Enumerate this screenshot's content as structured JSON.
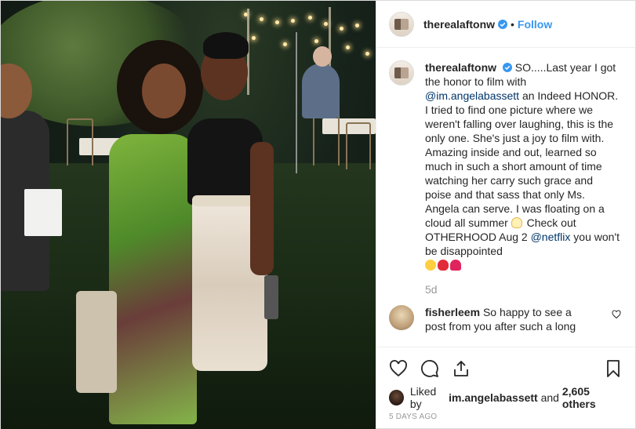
{
  "post": {
    "author": "therealaftonw",
    "dot": "•",
    "follow_label": "Follow"
  },
  "caption": {
    "author": "therealaftonw",
    "part1": "SO.....Last year I got the honor to film with ",
    "mention1": "@im.angelabassett",
    "part2": " an Indeed HONOR. I tried to find one picture where we weren't falling over laughing, this is the only one. She's just a joy to film with. Amazing inside and out, learned so much in such a short amount of time watching her carry such grace and poise and that sass that only Ms. Angela can serve. I was floating on a cloud all summer ",
    "part3": " Check out OTHERHOOD Aug 2 ",
    "mention2": "@netflix",
    "part4": " you won't be disappointed",
    "age": "5d",
    "emojis": [
      "cloud-emoji",
      "grin-emoji",
      "lips-emoji",
      "heart-emoji"
    ]
  },
  "comment": {
    "author": "fisherleem",
    "text": "So happy to see a post from you after such a long"
  },
  "likes": {
    "prefix": "Liked by ",
    "user": "im.angelabassett",
    "middle": " and ",
    "count": "2,605 others"
  },
  "date": "5 DAYS AGO",
  "colors": {
    "link_blue": "#3897f0",
    "mention": "#003569",
    "muted": "#999999",
    "verified": "#3897f0"
  }
}
